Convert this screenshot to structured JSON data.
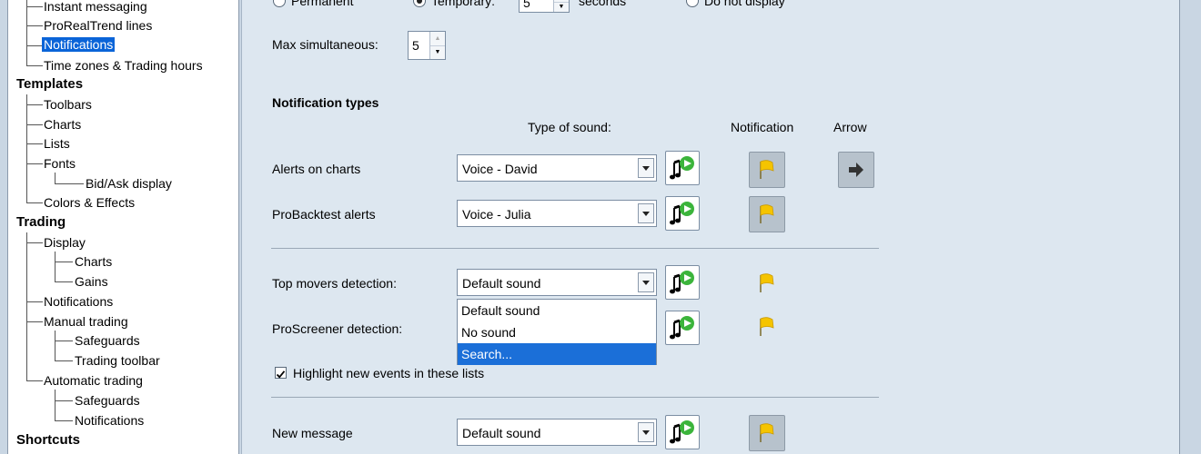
{
  "tree": {
    "items": [
      {
        "label": "Instant messaging"
      },
      {
        "label": "ProRealTrend lines"
      },
      {
        "label": "Notifications"
      },
      {
        "label": "Time zones & Trading hours"
      },
      {
        "label": "Templates"
      },
      {
        "label": "Toolbars"
      },
      {
        "label": "Charts"
      },
      {
        "label": "Lists"
      },
      {
        "label": "Fonts"
      },
      {
        "label": "Bid/Ask display"
      },
      {
        "label": "Colors & Effects"
      },
      {
        "label": "Trading"
      },
      {
        "label": "Display"
      },
      {
        "label": "Charts"
      },
      {
        "label": "Gains"
      },
      {
        "label": "Notifications"
      },
      {
        "label": "Manual trading"
      },
      {
        "label": "Safeguards"
      },
      {
        "label": "Trading toolbar"
      },
      {
        "label": "Automatic trading"
      },
      {
        "label": "Safeguards"
      },
      {
        "label": "Notifications"
      },
      {
        "label": "Shortcuts"
      }
    ]
  },
  "display_mode": {
    "permanent_label": "Permanent",
    "temporary_label": "Temporary:",
    "temporary_value": "5",
    "seconds_label": "seconds",
    "donotdisplay_label": "Do not display",
    "selected": "temporary"
  },
  "max_simultaneous": {
    "label": "Max simultaneous:",
    "value": "5"
  },
  "notification_types": {
    "heading": "Notification types",
    "col_sound": "Type of sound:",
    "col_notification": "Notification",
    "col_arrow": "Arrow",
    "rows": [
      {
        "label": "Alerts on charts",
        "sound": "Voice - David"
      },
      {
        "label": "ProBacktest alerts",
        "sound": "Voice - Julia"
      },
      {
        "label": "Top movers detection:",
        "sound": "Default sound"
      },
      {
        "label": "ProScreener detection:",
        "sound": "Default sound"
      },
      {
        "label": "New message",
        "sound": "Default sound"
      }
    ],
    "highlight_label": "Highlight new events in these lists",
    "highlight_checked": true
  },
  "dropdown": {
    "options": [
      "Default sound",
      "No sound",
      "Search..."
    ],
    "highlighted": "Search..."
  },
  "colors": {
    "selection": "#0a64d8",
    "flag": "#f5c400",
    "play_green": "#3bb43b"
  }
}
